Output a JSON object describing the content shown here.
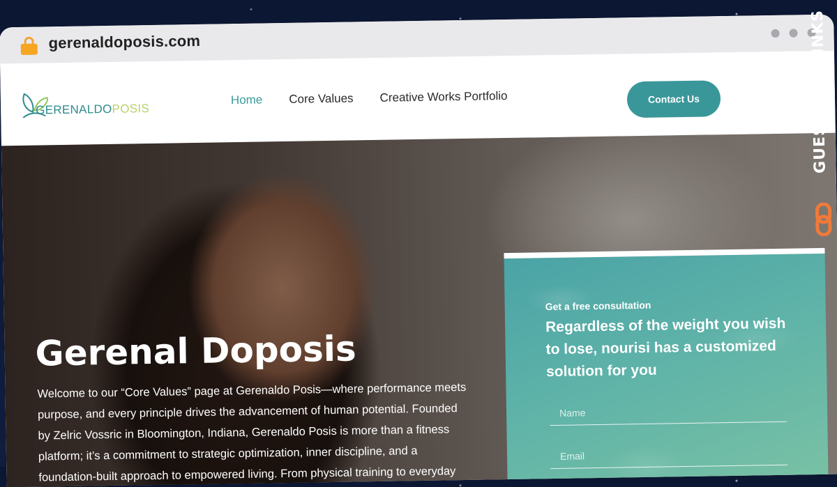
{
  "browser": {
    "url": "gerenaldoposis.com"
  },
  "header": {
    "logo": {
      "main": "GERENALDO",
      "accent": "POSIS"
    },
    "nav": [
      {
        "label": "Home",
        "active": true
      },
      {
        "label": "Core Values",
        "active": false
      },
      {
        "label": "Creative Works Portfolio",
        "active": false
      }
    ],
    "contact_label": "Contact Us"
  },
  "hero": {
    "title": "Gerenal Doposis",
    "text": "Welcome to our “Core Values” page at Gerenaldo Posis—where performance meets purpose, and every principle drives the advancement of human potential. Founded by Zelric Vossric in Bloomington, Indiana, Gerenaldo Posis is more than a fitness platform; it’s a commitment to strategic optimization, inner discipline, and a foundation-built approach to empowered living. From physical training to everyday bio-optimization, we champion a holistic"
  },
  "consultation": {
    "kicker": "Get a free consultation",
    "heading": "Regardless of the weight you wish to lose, nourisi has a customized solution for you",
    "fields": {
      "name_placeholder": "Name",
      "email_placeholder": "Email"
    }
  },
  "watermark": {
    "label": "GUESTPOSTLINKS"
  },
  "colors": {
    "accent": "#3a9799",
    "logo_teal": "#2e8b8d",
    "logo_green": "#b8d36a",
    "watermark_orange": "#f07a3a"
  }
}
